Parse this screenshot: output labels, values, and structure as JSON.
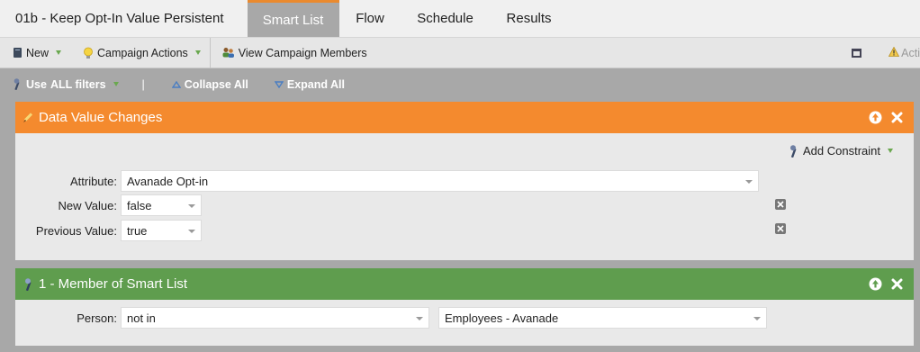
{
  "tabs": {
    "title": "01b - Keep Opt-In Value Persistent",
    "items": [
      "Smart List",
      "Flow",
      "Schedule",
      "Results"
    ]
  },
  "toolbar": {
    "new_label": "New",
    "campaign_actions_label": "Campaign Actions",
    "view_members_label": "View Campaign Members",
    "right_label": "Acti"
  },
  "filter_options": {
    "use_label": "Use",
    "use_value": "ALL filters",
    "divider": "|",
    "collapse_label": "Collapse All",
    "expand_label": "Expand All"
  },
  "filters": [
    {
      "title": "Data Value Changes",
      "color": "#f48a2e",
      "add_constraint_label": "Add Constraint",
      "rows": [
        {
          "label": "Attribute:",
          "value": "Avanade Opt-in"
        },
        {
          "label": "New Value:",
          "value": "false"
        },
        {
          "label": "Previous Value:",
          "value": "true"
        }
      ]
    },
    {
      "title": "1 - Member of Smart List",
      "color": "#5f9d4e",
      "rows": [
        {
          "label": "Person:",
          "operator": "not in",
          "value": "Employees - Avanade"
        }
      ]
    }
  ],
  "icons": {
    "new": "document-icon",
    "campaign_actions": "lightbulb-icon",
    "view_members": "people-icon",
    "filter_move_up": "arrow-up-circle-icon",
    "filter_remove": "close-icon",
    "constraint_remove": "x-box-icon"
  }
}
